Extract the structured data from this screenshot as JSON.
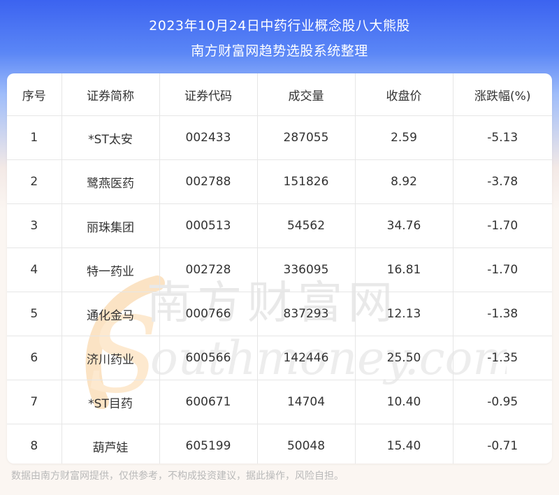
{
  "header": {
    "title_line1": "2023年10月24日中药行业概念股八大熊股",
    "title_line2": "南方财富网趋势选股系统整理"
  },
  "table": {
    "columns": [
      "序号",
      "证券简称",
      "证券代码",
      "成交量",
      "收盘价",
      "涨跌幅(%)"
    ],
    "rows": [
      [
        "1",
        "*ST太安",
        "002433",
        "287055",
        "2.59",
        "-5.13"
      ],
      [
        "2",
        "鹭燕医药",
        "002788",
        "151826",
        "8.92",
        "-3.78"
      ],
      [
        "3",
        "丽珠集团",
        "000513",
        "54562",
        "34.76",
        "-1.70"
      ],
      [
        "4",
        "特一药业",
        "002728",
        "336095",
        "16.81",
        "-1.70"
      ],
      [
        "5",
        "通化金马",
        "000766",
        "837293",
        "12.13",
        "-1.38"
      ],
      [
        "6",
        "济川药业",
        "600566",
        "142446",
        "25.50",
        "-1.35"
      ],
      [
        "7",
        "*ST目药",
        "600671",
        "14704",
        "10.40",
        "-0.95"
      ],
      [
        "8",
        "葫芦娃",
        "605199",
        "50048",
        "15.40",
        "-0.71"
      ]
    ]
  },
  "watermark": {
    "cn": "南方财富网",
    "en": "outhmoney.com",
    "logo_letter": "S"
  },
  "footer": {
    "disclaimer": "数据由南方财富网提供，仅供参考，不构成投资建议，据此操作，风险自担。"
  }
}
